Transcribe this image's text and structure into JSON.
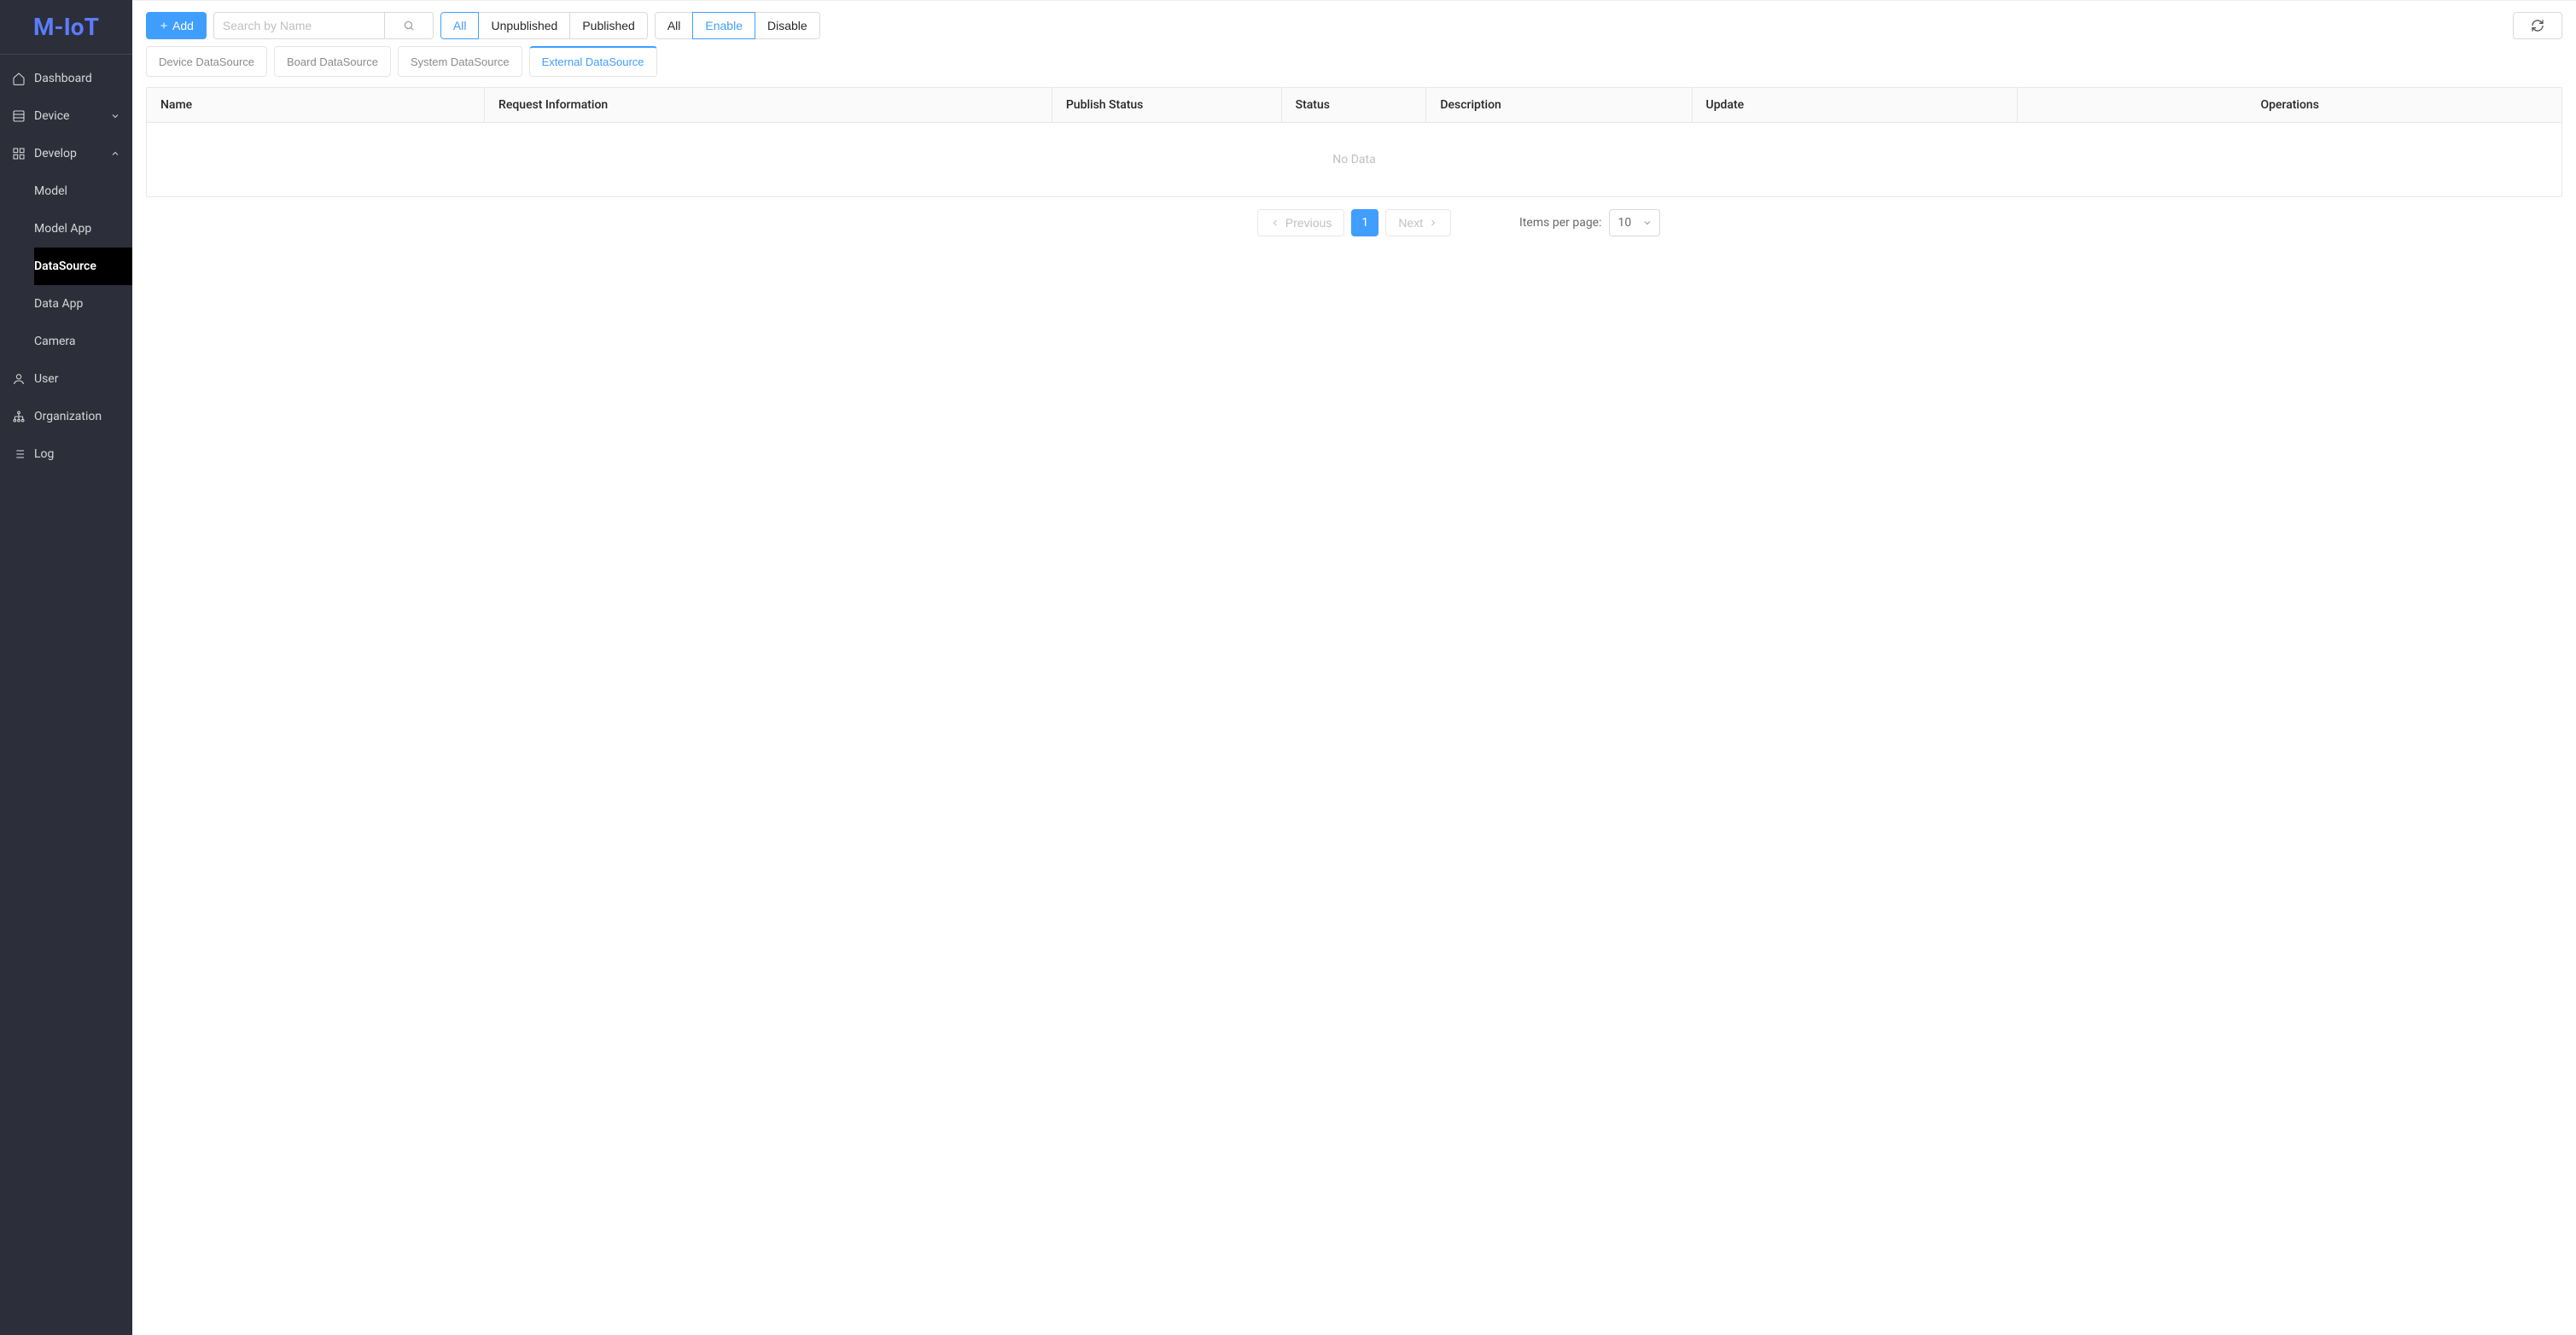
{
  "brand": "M-IoT",
  "sidebar": {
    "items": [
      {
        "label": "Dashboard",
        "icon": "home"
      },
      {
        "label": "Device",
        "icon": "grid",
        "expandable": true,
        "expanded": false
      },
      {
        "label": "Develop",
        "icon": "apps",
        "expandable": true,
        "expanded": true,
        "children": [
          {
            "label": "Model"
          },
          {
            "label": "Model App"
          },
          {
            "label": "DataSource",
            "active": true
          },
          {
            "label": "Data App"
          },
          {
            "label": "Camera"
          }
        ]
      },
      {
        "label": "User",
        "icon": "user"
      },
      {
        "label": "Organization",
        "icon": "org"
      },
      {
        "label": "Log",
        "icon": "list"
      }
    ]
  },
  "toolbar": {
    "add_label": "Add",
    "search_placeholder": "Search by Name",
    "publish_filter": {
      "options": [
        "All",
        "Unpublished",
        "Published"
      ],
      "active": "All"
    },
    "status_filter": {
      "options": [
        "All",
        "Enable",
        "Disable"
      ],
      "active": "Enable"
    }
  },
  "tabs": {
    "items": [
      "Device DataSource",
      "Board DataSource",
      "System DataSource",
      "External DataSource"
    ],
    "active": "External DataSource"
  },
  "table": {
    "columns": {
      "name": "Name",
      "request": "Request Information",
      "publish": "Publish Status",
      "status": "Status",
      "desc": "Description",
      "update": "Update",
      "ops": "Operations"
    },
    "empty_text": "No Data",
    "rows": []
  },
  "pagination": {
    "previous_label": "Previous",
    "next_label": "Next",
    "current_page": "1",
    "items_per_page_label": "Items per page:",
    "items_per_page_value": "10"
  }
}
